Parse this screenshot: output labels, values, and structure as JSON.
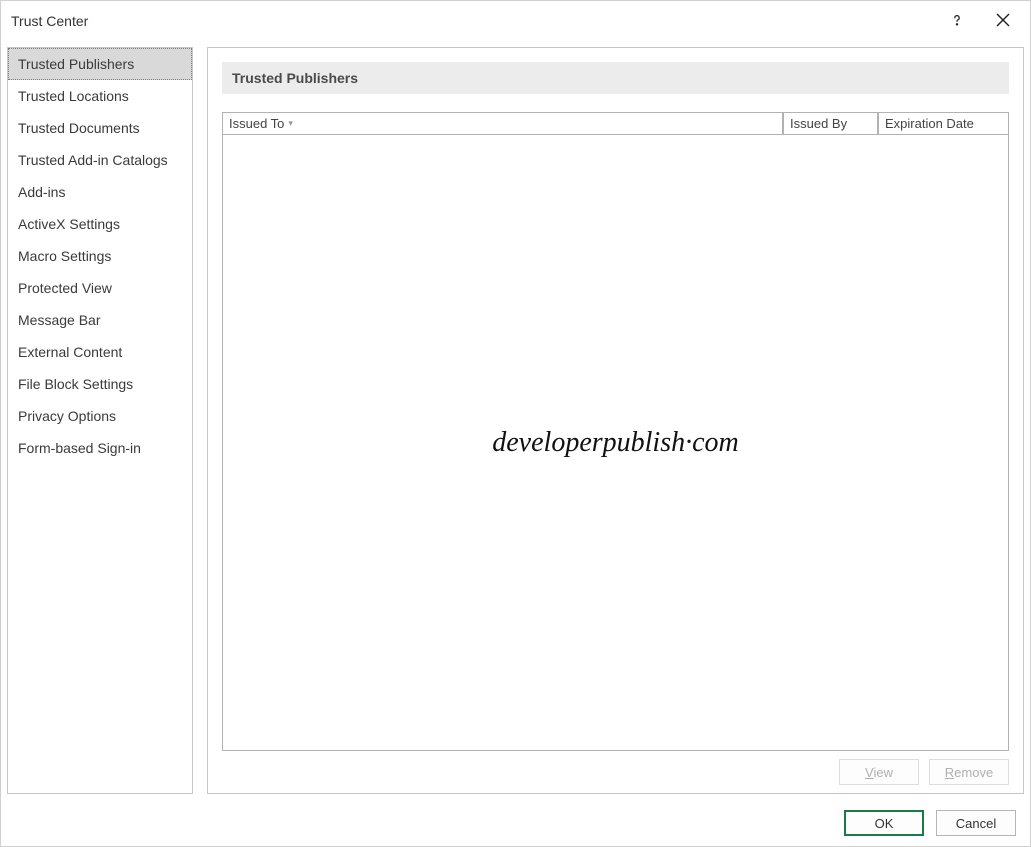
{
  "title": "Trust Center",
  "sidebar": {
    "items": [
      {
        "label": "Trusted Publishers",
        "selected": true
      },
      {
        "label": "Trusted Locations"
      },
      {
        "label": "Trusted Documents"
      },
      {
        "label": "Trusted Add-in Catalogs"
      },
      {
        "label": "Add-ins"
      },
      {
        "label": "ActiveX Settings"
      },
      {
        "label": "Macro Settings"
      },
      {
        "label": "Protected View"
      },
      {
        "label": "Message Bar"
      },
      {
        "label": "External Content"
      },
      {
        "label": "File Block Settings"
      },
      {
        "label": "Privacy Options"
      },
      {
        "label": "Form-based Sign-in"
      }
    ]
  },
  "main": {
    "section_title": "Trusted Publishers",
    "columns": {
      "issued_to": "Issued To",
      "issued_by": "Issued By",
      "expiration": "Expiration Date"
    },
    "rows": [],
    "watermark": "developerpublish·com",
    "buttons": {
      "view": "View",
      "remove": "Remove"
    }
  },
  "footer": {
    "ok": "OK",
    "cancel": "Cancel"
  }
}
